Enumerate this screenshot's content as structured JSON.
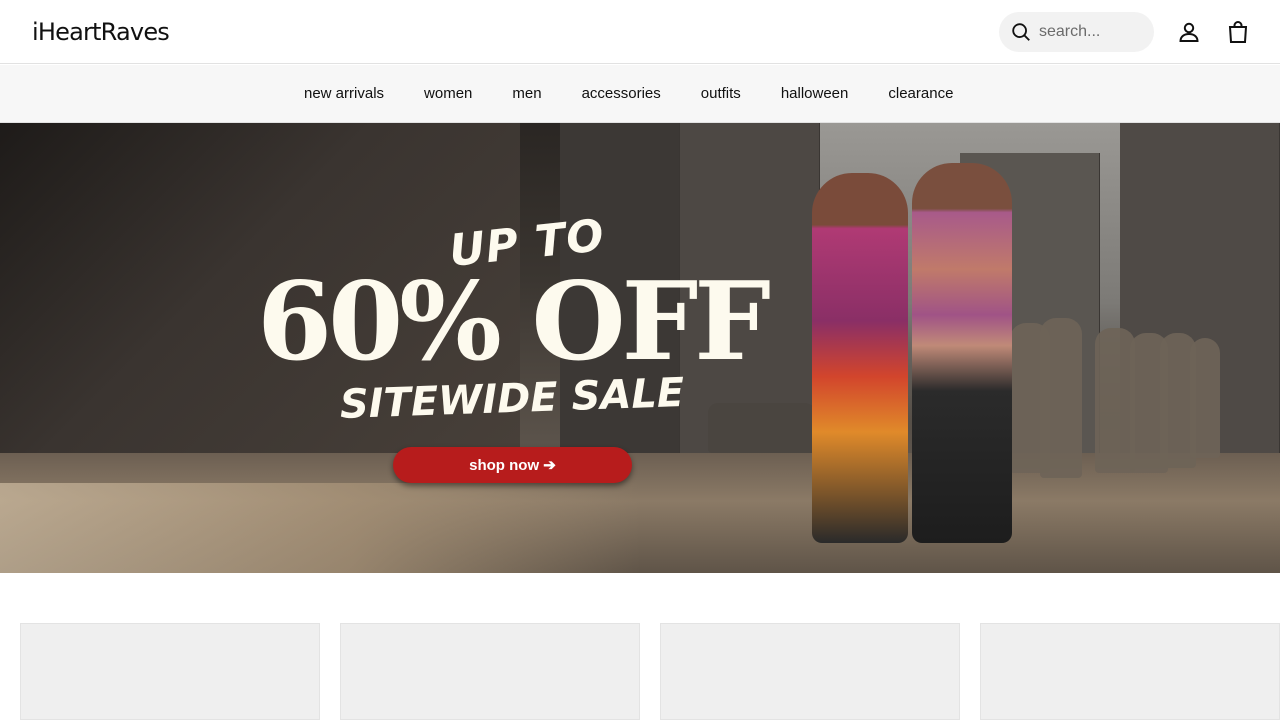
{
  "header": {
    "logo": "iHeartRaves",
    "search_placeholder": "search...",
    "icons": {
      "search": "search-icon",
      "account": "user-icon",
      "cart": "shopping-bag-icon"
    }
  },
  "nav": {
    "items": [
      "new arrivals",
      "women",
      "men",
      "accessories",
      "outfits",
      "halloween",
      "clearance"
    ]
  },
  "hero": {
    "line1": "UP TO",
    "line2": "60% OFF",
    "line3": "SITEWIDE SALE",
    "cta": "shop now ➔",
    "cta_color": "#b71c1c",
    "headline_color": "#fdfaee"
  },
  "product_cards": {
    "count": 4
  }
}
